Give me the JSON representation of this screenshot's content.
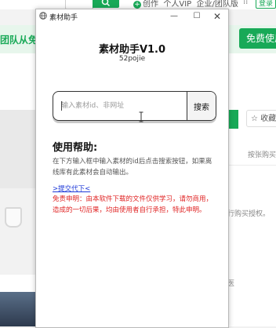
{
  "background_page": {
    "top_nav": {
      "create_label": "创作",
      "vip_label": "个人VIP",
      "enterprise_label": "企业/团队版",
      "login_label": "登录"
    },
    "team_banner_text": "团队从免费",
    "free_use_button": "免费使用",
    "collect_button": "☆ 收藏",
    "side_texts": [
      "按张购买",
      "行购买授权。",
      "医"
    ]
  },
  "dialog": {
    "title": "素材助手",
    "header": "素材助手V1.0",
    "subheader": "52pojie",
    "search": {
      "placeholder": "输入素材id、非网址",
      "button_label": "搜索"
    },
    "help": {
      "title": "使用帮助:",
      "description": "在下方输入框中输入素材的id后点击搜索按钮，如果离线库有此素材会自动输出。",
      "link_label": ">提交代下<",
      "disclaimer": "免责申明：由本软件下载的文件仅供学习，请勿商用，造成的一切后果，均由使用者自行承担，特此申明。"
    },
    "controls": {
      "minimize": "—",
      "maximize": "☐",
      "close": "✕"
    }
  },
  "colors": {
    "brand_green": "#18a957",
    "link_blue": "#1f3ad8",
    "disclaimer_red": "#e02424"
  }
}
